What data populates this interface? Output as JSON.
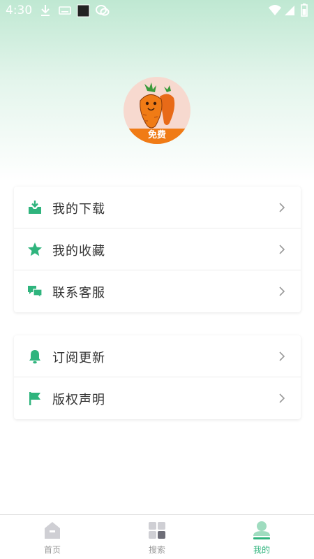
{
  "status_bar": {
    "time": "4:30",
    "icons": [
      "download-icon",
      "keyboard-icon",
      "square-app-icon",
      "chat-app-icon",
      "wifi-icon",
      "signal-icon",
      "battery-icon"
    ]
  },
  "profile": {
    "avatar_icon": "carrot-mascot-icon",
    "badge": "免费"
  },
  "menu_group_1": {
    "items": [
      {
        "label": "我的下载",
        "icon": "download-tray-icon"
      },
      {
        "label": "我的收藏",
        "icon": "star-icon"
      },
      {
        "label": "联系客服",
        "icon": "chat-bubbles-icon"
      }
    ]
  },
  "menu_group_2": {
    "items": [
      {
        "label": "订阅更新",
        "icon": "bell-icon"
      },
      {
        "label": "版权声明",
        "icon": "flag-icon"
      }
    ]
  },
  "bottom_nav": {
    "tabs": [
      {
        "label": "首页",
        "icon": "home-icon",
        "active": false
      },
      {
        "label": "搜索",
        "icon": "grid-icon",
        "active": false
      },
      {
        "label": "我的",
        "icon": "person-icon",
        "active": true
      }
    ]
  },
  "colors": {
    "accent": "#2fb47d",
    "badge": "#f07b15",
    "inactive_nav": "#999999"
  }
}
